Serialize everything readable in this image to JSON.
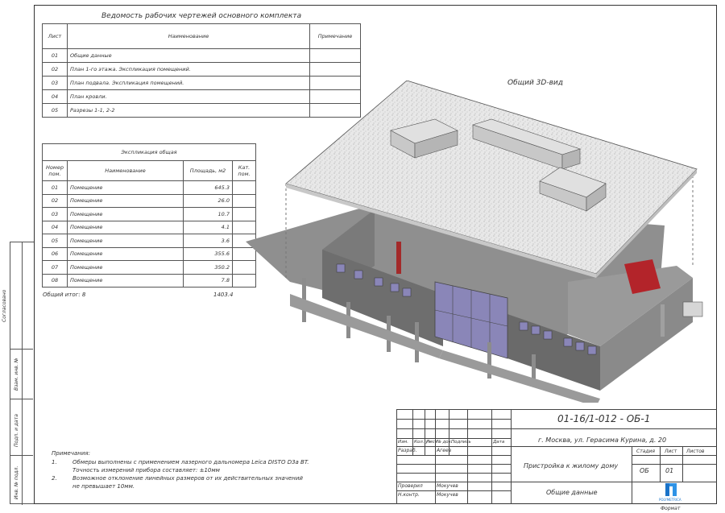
{
  "sheet_list": {
    "title": "Ведомость рабочих чертежей основного комплекта",
    "headers": [
      "Лист",
      "Наименование",
      "Примечание"
    ],
    "rows": [
      [
        "01",
        "Общие данные",
        ""
      ],
      [
        "02",
        "План 1-го этажа. Экспликация помещений.",
        ""
      ],
      [
        "03",
        "План подвала. Экспликация помещений.",
        ""
      ],
      [
        "04",
        "План кровли.",
        ""
      ],
      [
        "05",
        "Разрезы 1-1, 2-2",
        ""
      ]
    ]
  },
  "explication": {
    "title": "Экспликация общая",
    "headers": [
      "Номер пом.",
      "Наименование",
      "Площадь, м2",
      "Кат. пом."
    ],
    "rows": [
      [
        "01",
        "Помещение",
        "645.3",
        ""
      ],
      [
        "02",
        "Помещение",
        "26.0",
        ""
      ],
      [
        "03",
        "Помещение",
        "10.7",
        ""
      ],
      [
        "04",
        "Помещение",
        "4.1",
        ""
      ],
      [
        "05",
        "Помещение",
        "3.6",
        ""
      ],
      [
        "06",
        "Помещение",
        "355.6",
        ""
      ],
      [
        "07",
        "Помещение",
        "350.2",
        ""
      ],
      [
        "08",
        "Помещение",
        "7.8",
        ""
      ]
    ],
    "total_label": "Общий итог: 8",
    "total_value": "1403.4"
  },
  "view_label": "Общий 3D-вид",
  "notes": {
    "title": "Примечания:",
    "items": [
      {
        "n": "1.",
        "line1": "Обмеры выполнены с применением лазерного дальномера Leica DISTO D3a BT.",
        "line2": "Точность измерений прибора составляет: ±10мм"
      },
      {
        "n": "2.",
        "line1": "Возможное отклонение линейных размеров от их действительных значений",
        "line2": "не превышает 10мм."
      }
    ]
  },
  "side_labels": [
    "Согласовано",
    "Взам. инв. №",
    "Подп. и дата",
    "Инв. № подл."
  ],
  "stamp": {
    "code": "01-16/1-012 - ОБ-1",
    "address": "г. Москва, ул. Герасима Курина, д. 20",
    "header_cells": [
      "Изм.",
      "Кол. уч",
      "Лист",
      "№ док.",
      "Подпись",
      "Дата"
    ],
    "roles": [
      {
        "role": "Разраб.",
        "name": "Агеев"
      },
      {
        "role": "Проверил",
        "name": "Мокучев"
      },
      {
        "role": "Н.контр.",
        "name": "Мокучев"
      }
    ],
    "object": "Пристройка к жилому дому",
    "stage_label": "Стадия",
    "sheet_label": "Лист",
    "sheets_label": "Листов",
    "stage": "ОБ",
    "sheet": "01",
    "sheets": "",
    "doc_title": "Общие данные",
    "logo_text": "POLYMETRICA",
    "format_label": "Формат"
  },
  "colors": {
    "roof": "#e6e6e6",
    "wall": "#6f6f6f",
    "floor": "#8c8c8c",
    "accent_red": "#b3242a",
    "glass": "#8a86b8"
  }
}
